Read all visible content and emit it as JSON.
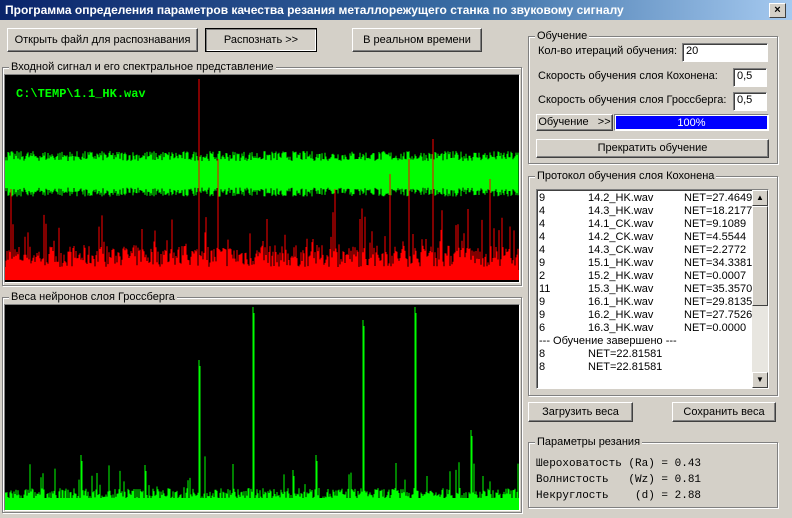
{
  "window": {
    "title": "Программа определения параметров качества резания металлорежущего станка по звуковому сигналу",
    "close": "×"
  },
  "toolbar": {
    "open_label": "Открыть файл для распознавания",
    "recognize_label": "Распознать >>",
    "realtime_label": "В реальном времени"
  },
  "signal_panel": {
    "title": "Входной сигнал и его спектральное представление",
    "file_path": "C:\\TEMP\\1.1_HK.wav"
  },
  "weights_panel": {
    "title": "Веса нейронов слоя Гроссберга"
  },
  "training": {
    "title": "Обучение",
    "iterations_label": "Кол-во итераций обучения:",
    "iterations_value": "20",
    "kohonen_rate_label": "Скорость обучения слоя Кохонена:",
    "kohonen_rate_value": "0,5",
    "grossberg_rate_label": "Скорость обучения слоя Гроссберга:",
    "grossberg_rate_value": "0,5",
    "train_button": "Обучение   >>",
    "progress_text": "100%",
    "progress": 1.0,
    "stop_button": "Прекратить обучение"
  },
  "protocol": {
    "title": "Протокол обучения слоя Кохонена",
    "rows": [
      {
        "n": "9",
        "file": "14.2_HK.wav",
        "net": "NET=27.4649"
      },
      {
        "n": "4",
        "file": "14.3_HK.wav",
        "net": "NET=18.2177"
      },
      {
        "n": "4",
        "file": "14.1_CK.wav",
        "net": "NET=9.1089"
      },
      {
        "n": "4",
        "file": "14.2_CK.wav",
        "net": "NET=4.5544"
      },
      {
        "n": "4",
        "file": "14.3_CK.wav",
        "net": "NET=2.2772"
      },
      {
        "n": "9",
        "file": "15.1_HK.wav",
        "net": "NET=34.3381"
      },
      {
        "n": "2",
        "file": "15.2_HK.wav",
        "net": "NET=0.0007"
      },
      {
        "n": "11",
        "file": "15.3_HK.wav",
        "net": "NET=35.3570"
      },
      {
        "n": "9",
        "file": "16.1_HK.wav",
        "net": "NET=29.8135"
      },
      {
        "n": "9",
        "file": "16.2_HK.wav",
        "net": "NET=27.7526"
      },
      {
        "n": "6",
        "file": "16.3_HK.wav",
        "net": "NET=0.0000"
      }
    ],
    "done_line": "--- Обучение завершено ---",
    "result_rows": [
      {
        "n": "8",
        "net": "NET=22.81581"
      },
      {
        "n": "8",
        "net": "NET=22.81581"
      }
    ],
    "load_button": "Загрузить веса",
    "save_button": "Сохранить веса"
  },
  "cut_params": {
    "title": "Параметры резания",
    "lines": [
      "Шероховатость (Ra) = 0.43",
      "Волнистость   (Wz) = 0.81",
      "Некруглость    (d) = 2.88"
    ]
  },
  "colors": {
    "signal": "#00ff00",
    "spectrum": "#ff0000",
    "weights": "#00ff00",
    "title_bar": "#0a246a",
    "progress": "#0000ff"
  }
}
